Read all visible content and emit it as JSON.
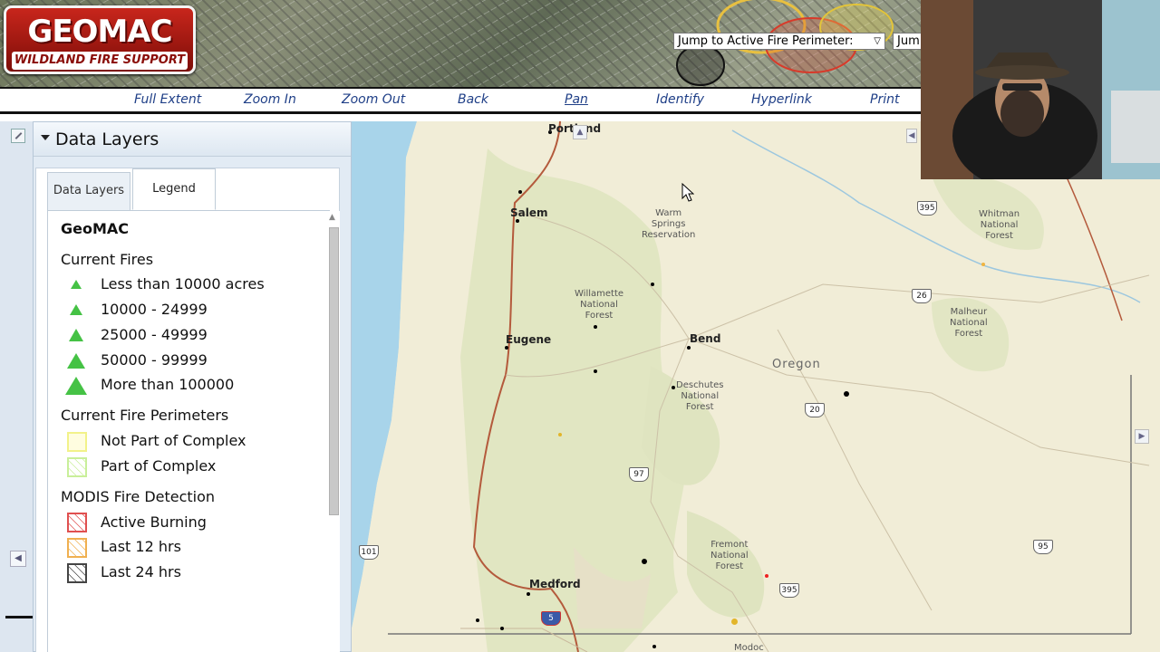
{
  "header": {
    "logo_main": "GEOMAC",
    "logo_sub": "WILDLAND FIRE SUPPORT",
    "jump_select": "Jump to Active Fire Perimeter:",
    "jump_select2": "Jum"
  },
  "toolbar": {
    "full_extent": "Full Extent",
    "zoom_in": "Zoom In",
    "zoom_out": "Zoom Out",
    "back": "Back",
    "pan": "Pan",
    "identify": "Identify",
    "hyperlink": "Hyperlink",
    "print": "Print"
  },
  "panel": {
    "title": "Data Layers",
    "tabs": [
      "Data Layers",
      "Legend"
    ],
    "active_tab": "Legend"
  },
  "legend": {
    "title": "GeoMAC",
    "current_fires": {
      "heading": "Current Fires",
      "items": [
        "Less than 10000 acres",
        "10000 - 24999",
        "25000 - 49999",
        "50000 - 99999",
        "More than 100000"
      ],
      "color": "#45c245"
    },
    "perimeters": {
      "heading": "Current Fire Perimeters",
      "items": [
        "Not Part of Complex",
        "Part of Complex"
      ],
      "colors": [
        "#f2f28a",
        "#c9ef9a"
      ]
    },
    "modis": {
      "heading": "MODIS Fire Detection",
      "items": [
        "Active Burning",
        "Last 12 hrs",
        "Last 24 hrs"
      ],
      "colors": [
        "#e05050",
        "#f0b050",
        "#444444"
      ]
    }
  },
  "map": {
    "cities": [
      "Portland",
      "Salem",
      "Eugene",
      "Bend",
      "Medford"
    ],
    "state": "Oregon",
    "regions": {
      "warm_springs": [
        "Warm",
        "Springs",
        "Reservation"
      ],
      "willamette": [
        "Willamette",
        "National",
        "Forest"
      ],
      "deschutes": [
        "Deschutes",
        "National",
        "Forest"
      ],
      "fremont": [
        "Fremont",
        "National",
        "Forest"
      ],
      "malheur": [
        "Malheur",
        "National",
        "Forest"
      ],
      "whitman": [
        "Whitman",
        "National",
        "Forest"
      ],
      "modoc": [
        "Modoc"
      ]
    },
    "highways": [
      "395",
      "26",
      "20",
      "97",
      "101",
      "95",
      "395",
      "5"
    ],
    "colors": {
      "land": "#f1edd7",
      "forest": "#dfe4c0",
      "water": "#a8d4ea",
      "road": "#b45a3c"
    }
  }
}
